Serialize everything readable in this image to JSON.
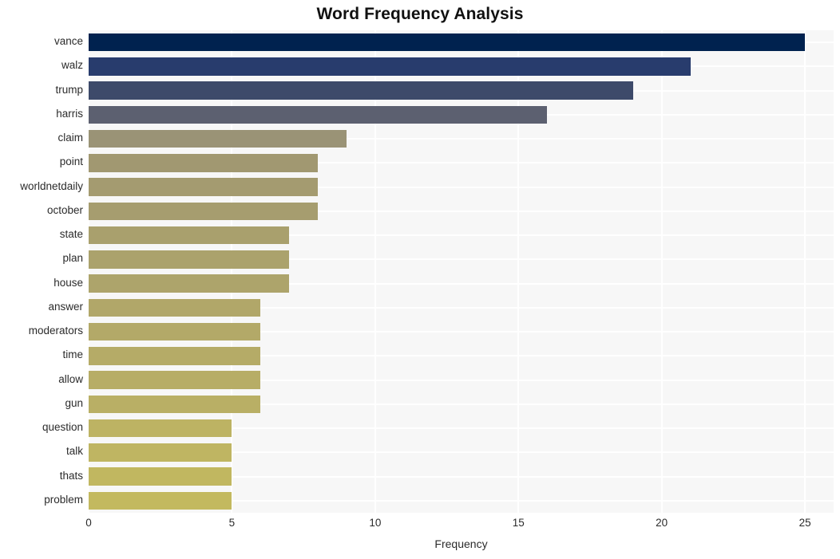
{
  "chart_data": {
    "type": "bar",
    "orientation": "horizontal",
    "title": "Word Frequency Analysis",
    "xlabel": "Frequency",
    "ylabel": "",
    "categories": [
      "vance",
      "walz",
      "trump",
      "harris",
      "claim",
      "point",
      "worldnetdaily",
      "october",
      "state",
      "plan",
      "house",
      "answer",
      "moderators",
      "time",
      "allow",
      "gun",
      "question",
      "talk",
      "thats",
      "problem"
    ],
    "values": [
      25,
      21,
      19,
      16,
      9,
      8,
      8,
      8,
      7,
      7,
      7,
      6,
      6,
      6,
      6,
      6,
      5,
      5,
      5,
      5
    ],
    "xlim": [
      0,
      26
    ],
    "xticks": [
      0,
      5,
      10,
      15,
      20,
      25
    ],
    "xtick_labels": [
      "0",
      "5",
      "10",
      "15",
      "20",
      "25"
    ],
    "grid": true,
    "grid_color": "#ffffff",
    "plot_background": "#f7f7f7",
    "figure_background": "#ffffff",
    "legend": null,
    "bar_colors": [
      "#00224f",
      "#283c6d",
      "#3d4a6a",
      "#5c6070",
      "#9a9376",
      "#a19871",
      "#a49b70",
      "#a69d6f",
      "#a9a06d",
      "#aba26c",
      "#ada46b",
      "#b1a769",
      "#b3a968",
      "#b5ab67",
      "#b7ad66",
      "#b9af65",
      "#bdb363",
      "#bfb562",
      "#c1b760",
      "#c3b95f"
    ]
  }
}
